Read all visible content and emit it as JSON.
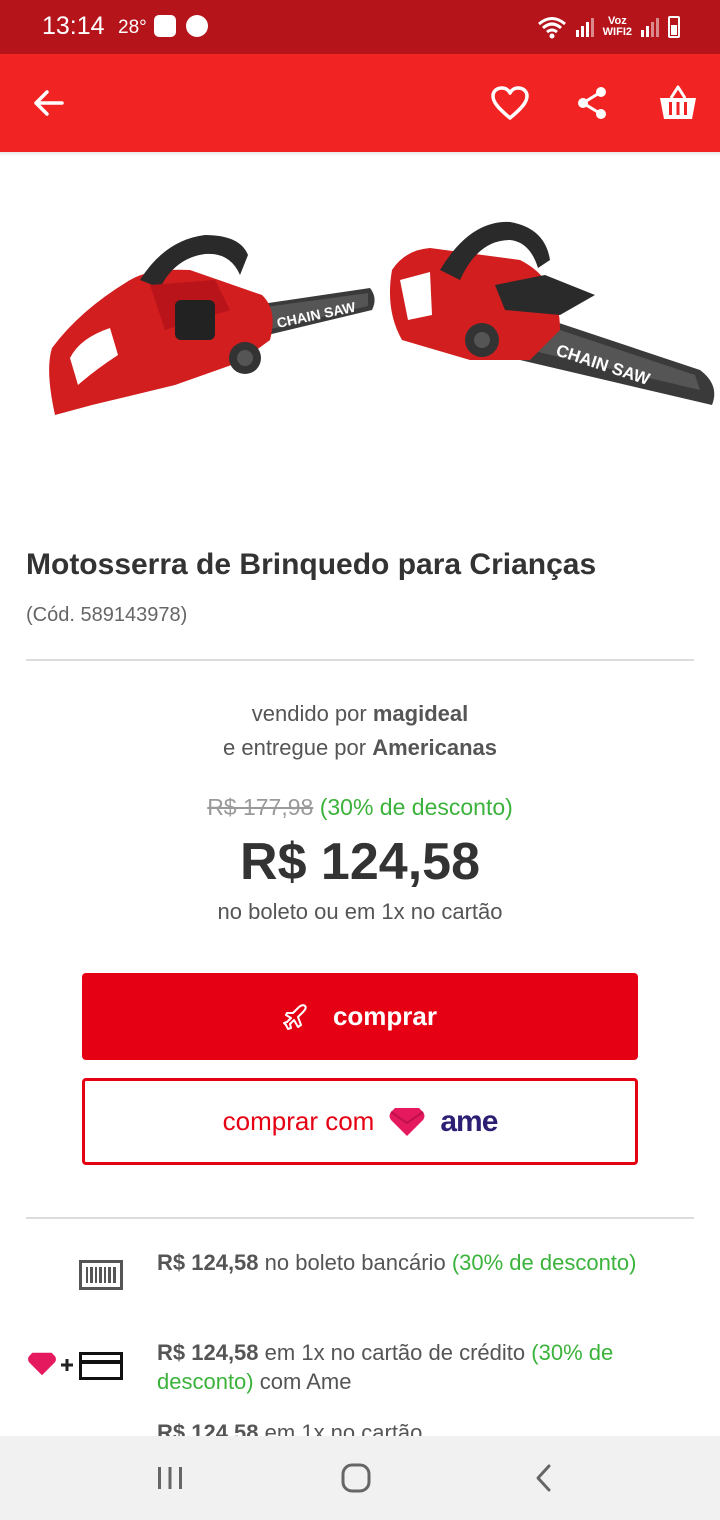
{
  "status_bar": {
    "time": "13:14",
    "temperature": "28°",
    "network_label_top": "Voz",
    "network_label_bottom": "WIFI2"
  },
  "header": {
    "icons": [
      "back-arrow-icon",
      "heart-icon",
      "share-icon",
      "basket-icon"
    ],
    "color": "#f22323"
  },
  "product": {
    "title": "Motosserra de Brinquedo para Crianças",
    "code": "(Cód. 589143978)",
    "image_label": "CHAIN SAW"
  },
  "seller": {
    "sold_prefix": "vendido por",
    "sold_by": "magideal",
    "delivered_prefix": "e entregue por",
    "delivered_by": "Americanas"
  },
  "pricing": {
    "old_price": "R$ 177,98",
    "discount": "(30% de desconto)",
    "price": "R$ 124,58",
    "note": "no boleto ou em 1x no cartão"
  },
  "actions": {
    "buy_label": "comprar",
    "ame_prefix": "comprar com",
    "ame_brand": "ame"
  },
  "payment_options": [
    {
      "amount": "R$ 124,58",
      "text": "no boleto bancário",
      "discount": "(30% de desconto)",
      "suffix": ""
    },
    {
      "amount": "R$ 124,58",
      "text": "em 1x no cartão de crédito",
      "discount": "(30% de desconto)",
      "suffix": "com Ame"
    },
    {
      "amount": "R$ 124,58",
      "text": "em 1x no cartão",
      "discount": "",
      "suffix": ""
    }
  ],
  "colors": {
    "status_bar": "#b4141a",
    "accent": "#e60014",
    "discount_green": "#3bb33b",
    "ame_navy": "#2d1f73"
  }
}
